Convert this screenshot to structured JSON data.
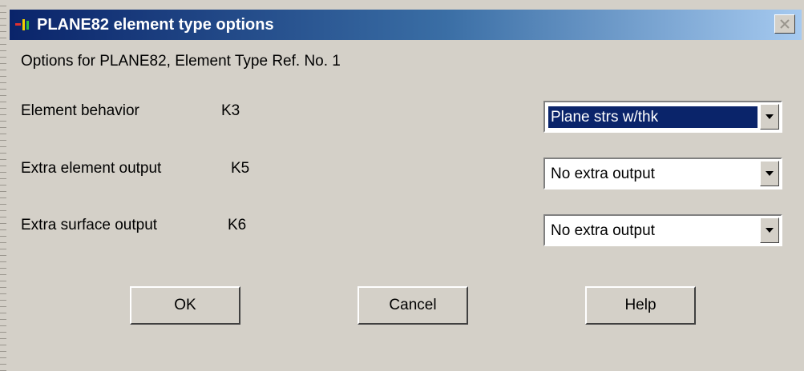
{
  "window": {
    "title": "PLANE82 element type options",
    "close_icon": "close-icon",
    "app_icon": "ansys-icon",
    "colors": {
      "titlebar_start": "#0a246a",
      "titlebar_end": "#a6caf0",
      "face": "#d4d0c8",
      "selection": "#0a246a"
    }
  },
  "header": {
    "text": "Options for PLANE82, Element Type Ref. No. 1"
  },
  "options": [
    {
      "label": "Element behavior",
      "key": "K3",
      "value": "Plane strs w/thk",
      "selected": true
    },
    {
      "label": "Extra element output",
      "key": "K5",
      "value": "No extra output",
      "selected": false
    },
    {
      "label": "Extra surface output",
      "key": "K6",
      "value": "No extra output",
      "selected": false
    }
  ],
  "buttons": {
    "ok": "OK",
    "cancel": "Cancel",
    "help": "Help"
  }
}
